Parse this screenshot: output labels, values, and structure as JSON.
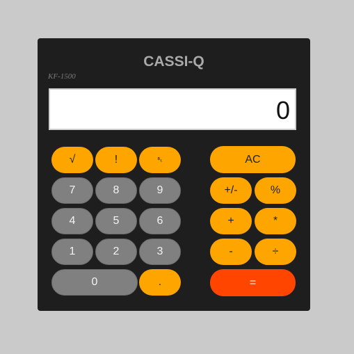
{
  "brand": "CASSI-Q",
  "model": "KF-1500",
  "display": "0",
  "keys": {
    "sqrt": "√",
    "factorial": "!",
    "b_s": "ᴮ₅",
    "ac": "AC",
    "seven": "7",
    "eight": "8",
    "nine": "9",
    "sign": "+/-",
    "percent": "%",
    "four": "4",
    "five": "5",
    "six": "6",
    "plus": "+",
    "multiply": "*",
    "one": "1",
    "two": "2",
    "three": "3",
    "minus": "-",
    "divide": "÷",
    "zero": "0",
    "decimal": ".",
    "equals": "="
  },
  "colors": {
    "gray": "#808080",
    "orange": "#ffa500",
    "red": "#ff4500",
    "body": "#1e1e1e"
  }
}
